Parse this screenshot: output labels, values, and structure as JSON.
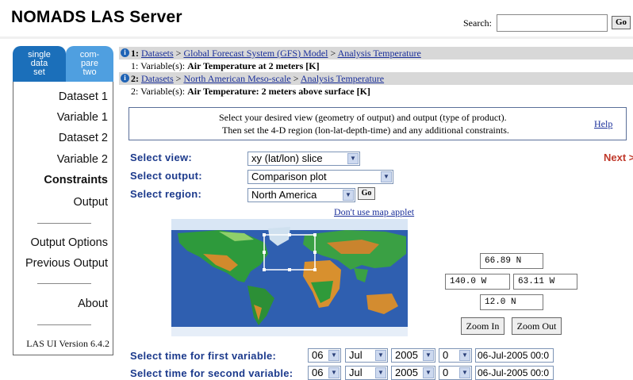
{
  "header": {
    "title": "NOMADS LAS Server",
    "search_label": "Search:",
    "search_value": "",
    "go_label": "Go"
  },
  "tabs": [
    {
      "line1": "single",
      "line2": "data",
      "line3": "set"
    },
    {
      "line1": "com-",
      "line2": "pare",
      "line3": "two"
    }
  ],
  "sidebar": {
    "items": [
      "Dataset 1",
      "Variable 1",
      "Dataset 2",
      "Variable 2",
      "Constraints",
      "Output",
      "Output Options",
      "Previous Output",
      "About"
    ],
    "version": "LAS UI Version 6.4.2"
  },
  "breadcrumbs": [
    {
      "num": "1:",
      "datasets": "Datasets",
      "sep": ">",
      "dataset": "Global Forecast System (GFS) Model",
      "variable_link": "Analysis Temperature",
      "var_prefix": "1: Variable(s):",
      "var_name": "Air Temperature at 2 meters [K]"
    },
    {
      "num": "2:",
      "datasets": "Datasets",
      "sep": ">",
      "dataset": "North American Meso-scale",
      "variable_link": "Analysis Temperature",
      "var_prefix": "2: Variable(s):",
      "var_name": "Air Temperature: 2 meters above surface [K]"
    }
  ],
  "instructions": {
    "line1": "Select your desired view (geometry of output) and output (type of product).",
    "line2": "Then set the 4-D region (lon-lat-depth-time) and any additional constraints.",
    "help": "Help"
  },
  "form": {
    "view_label": "Select view:",
    "view_value": "xy (lat/lon) slice",
    "output_label": "Select output:",
    "output_value": "Comparison plot",
    "region_label": "Select region:",
    "region_value": "North America",
    "go_label": "Go",
    "next_label": "Next >",
    "map_link": "Don't use map applet"
  },
  "coords": {
    "north": "66.89 N",
    "west": "140.0 W",
    "east": "63.11 W",
    "south": "12.0 N"
  },
  "zoom": {
    "in": "Zoom In",
    "out": "Zoom Out"
  },
  "time": {
    "first_label": "Select time for first variable:",
    "second_label": "Select time for second variable:",
    "first": {
      "day": "06",
      "month": "Jul",
      "year": "2005",
      "hour": "0",
      "text": "06-Jul-2005 00:0"
    },
    "second": {
      "day": "06",
      "month": "Jul",
      "year": "2005",
      "hour": "0",
      "text": "06-Jul-2005 00:0"
    }
  },
  "colors": {
    "tab_active": "#1b6fba",
    "tab_inactive": "#4f9fe0",
    "label_blue": "#1c3a8c",
    "link_blue": "#1a2f9a",
    "next_red": "#c0392b"
  },
  "icons": [
    "info-icon",
    "chevron-down-icon"
  ]
}
